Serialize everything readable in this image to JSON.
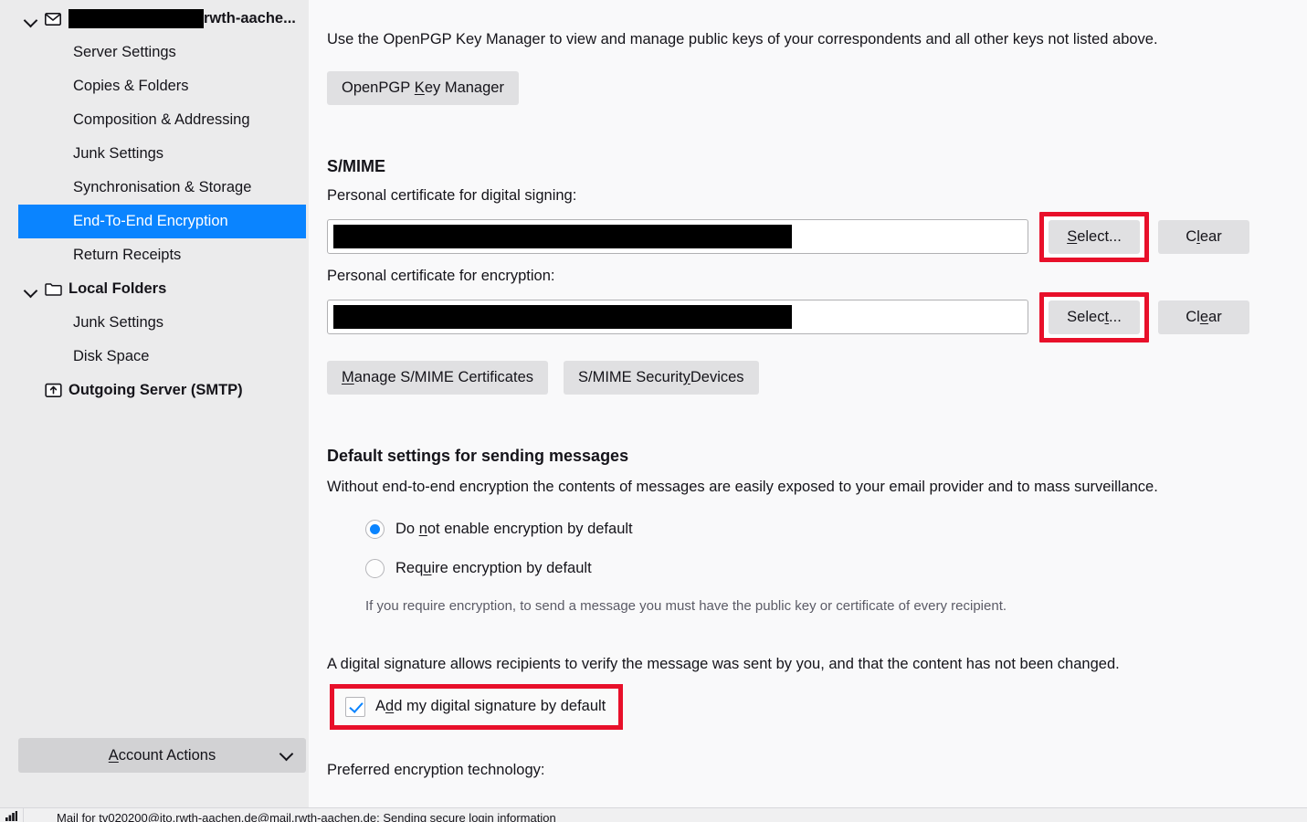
{
  "sidebar": {
    "account": {
      "name_redacted": true,
      "name_tail": "rwth-aache...",
      "icon": "envelope-icon",
      "twisty": "chevron-down-icon"
    },
    "items": [
      {
        "label": "Server Settings",
        "selected": false
      },
      {
        "label": "Copies & Folders",
        "selected": false
      },
      {
        "label": "Composition & Addressing",
        "selected": false
      },
      {
        "label": "Junk Settings",
        "selected": false
      },
      {
        "label": "Synchronisation & Storage",
        "selected": false
      },
      {
        "label": "End-To-End Encryption",
        "selected": true
      },
      {
        "label": "Return Receipts",
        "selected": false
      }
    ],
    "local_folders": {
      "label": "Local Folders",
      "icon": "folder-icon",
      "items": [
        {
          "label": "Junk Settings"
        },
        {
          "label": "Disk Space"
        }
      ]
    },
    "outgoing_server": {
      "label": "Outgoing Server (SMTP)",
      "icon": "outgoing-server-icon"
    },
    "account_actions": {
      "label": "Account Actions",
      "accesskey": "A",
      "chevron": "chevron-down-icon"
    }
  },
  "main": {
    "openpgp": {
      "intro": "Use the OpenPGP Key Manager to view and manage public keys of your correspondents and all other keys not listed above.",
      "key_manager_button": "OpenPGP Key Manager",
      "key_manager_accesskey": "K"
    },
    "smime": {
      "heading": "S/MIME",
      "signing_label": "Personal certificate for digital signing:",
      "signing_value_redacted": true,
      "signing_select_button": "Select...",
      "signing_select_accesskey": "S",
      "signing_clear_button": "Clear",
      "signing_clear_accesskey": "l",
      "encryption_label": "Personal certificate for encryption:",
      "encryption_value_redacted": true,
      "encryption_select_button": "Select...",
      "encryption_select_accesskey": "t",
      "encryption_clear_button": "Clear",
      "encryption_clear_accesskey": "e",
      "manage_button": "Manage S/MIME Certificates",
      "manage_accesskey": "M",
      "devices_button": "S/MIME Security Devices",
      "devices_accesskey": "y"
    },
    "defaults": {
      "heading": "Default settings for sending messages",
      "description": "Without end-to-end encryption the contents of messages are easily exposed to your email provider and to mass surveillance.",
      "radios": [
        {
          "label": "Do not enable encryption by default",
          "checked": true,
          "accesskey": "n"
        },
        {
          "label": "Require encryption by default",
          "checked": false,
          "accesskey": "u"
        }
      ],
      "radio_hint": "If you require encryption, to send a message you must have the public key or certificate of every recipient.",
      "signature_description": "A digital signature allows recipients to verify the message was sent by you, and that the content has not been changed.",
      "signature_checkbox_label": "Add my digital signature by default",
      "signature_checkbox_checked": true,
      "signature_accesskey": "d",
      "preferred_tech_label": "Preferred encryption technology:"
    }
  },
  "statusbar": {
    "icon": "activity-indicator-icon",
    "text": "Mail for tv020200@ito.rwth-aachen.de@mail.rwth-aachen.de: Sending secure login information"
  },
  "colors": {
    "selection_blue": "#0a84ff",
    "highlight_red": "#e8102a",
    "sidebar_bg": "#ebebec",
    "content_bg": "#f9f9fa",
    "button_bg": "#e0e0e2"
  }
}
